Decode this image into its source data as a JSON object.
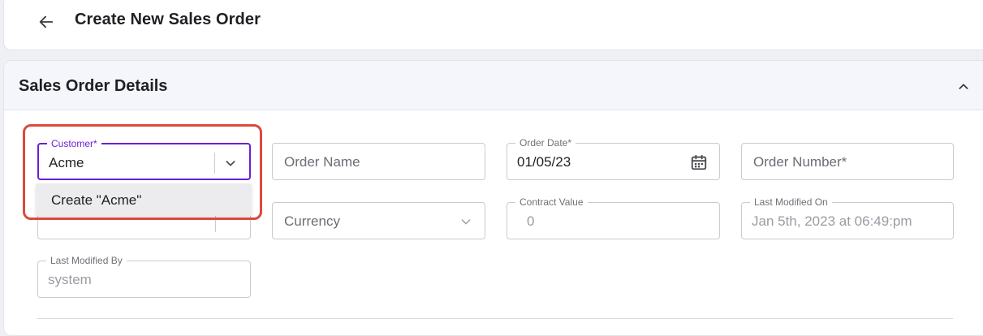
{
  "header": {
    "title": "Create New Sales Order",
    "back_icon": "arrow-left-icon"
  },
  "section": {
    "title": "Sales Order Details",
    "collapse_icon": "chevron-up-icon"
  },
  "fields": {
    "customer": {
      "label": "Customer",
      "required": "*",
      "value": "Acme",
      "icon": "chevron-down-icon"
    },
    "order_name": {
      "placeholder": "Order Name"
    },
    "order_date": {
      "label": "Order Date",
      "required": "*",
      "value": "01/05/23",
      "icon": "calendar-icon"
    },
    "order_number": {
      "placeholder": "Order Number",
      "required": "*"
    },
    "currency": {
      "placeholder": "Currency",
      "icon": "chevron-down-icon"
    },
    "contract_value": {
      "label": "Contract Value",
      "value": "0"
    },
    "last_modified_on": {
      "label": "Last Modified On",
      "value": "Jan 5th, 2023 at 06:49:pm"
    },
    "last_modified_by": {
      "label": "Last Modified By",
      "value": "system"
    }
  },
  "dropdown": {
    "items": [
      {
        "label": "Create \"Acme\""
      }
    ]
  },
  "colors": {
    "accent": "#6a1fd6",
    "highlight": "#db4a3b"
  }
}
